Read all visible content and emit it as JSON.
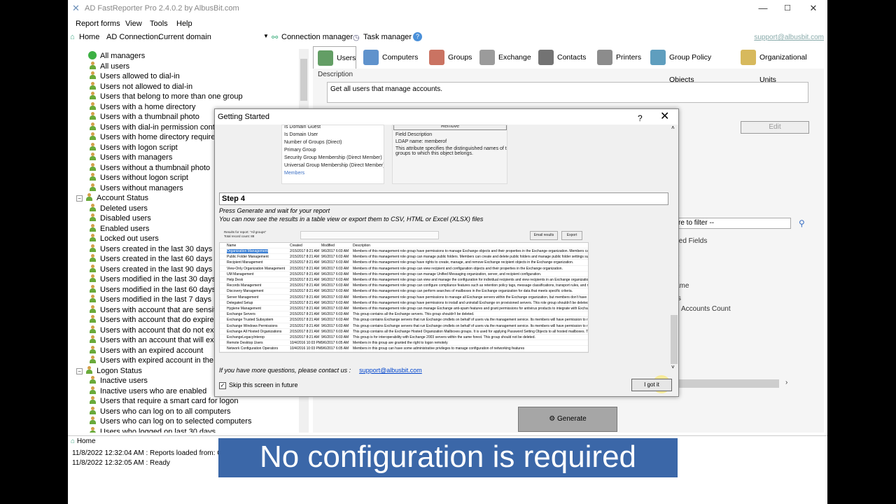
{
  "window": {
    "title": "AD FastReporter Pro 2.4.0.2 by AlbusBit.com",
    "minimize": "—",
    "maximize": "☐",
    "close": "✕"
  },
  "menu": [
    "Report forms",
    "View",
    "Tools",
    "Help"
  ],
  "toolbar": {
    "home": "Home",
    "ad_connection_label": "AD Connection:",
    "ad_connection_value": "Current domain",
    "connection_manager": "Connection manager",
    "task_manager": "Task manager",
    "help": "?",
    "support": "support@albusbit.com"
  },
  "tree": {
    "items_group1": [
      "All managers",
      "All users",
      "Users allowed to dial-in",
      "Users not allowed to dial-in",
      "Users that belong to more than one group",
      "Users with a home directory",
      "Users with a thumbnail photo",
      "Users with dial-in permission contro",
      "Users with home directory required",
      "Users with logon script",
      "Users with managers",
      "Users without a thumbnail photo",
      "Users without logon script",
      "Users without managers"
    ],
    "account_status": "Account Status",
    "items_group2": [
      "Deleted users",
      "Disabled users",
      "Enabled users",
      "Locked out users",
      "Users created in the last 30 days",
      "Users created in the last 60 days",
      "Users created in the last 90 days",
      "Users modified in the last 30 days",
      "Users modified in the last 60 days",
      "Users modified in the last 7 days",
      "Users with account that are sensitiv",
      "Users with account that do expire",
      "Users with account that do not expi",
      "Users with an account that will expi",
      "Users with an expired account",
      "Users with expired account in the la"
    ],
    "logon_status": "Logon Status",
    "items_group3": [
      "Inactive users",
      "Inactive users who are enabled",
      "Users that require a smart card for logon",
      "Users who can log on to all computers",
      "Users who can log on to selected computers",
      "Users who logged on last 30 days"
    ]
  },
  "tabs": [
    "Users",
    "Computers",
    "Groups",
    "Exchange",
    "Contacts",
    "Printers",
    "Group Policy Objects",
    "Organizational Units"
  ],
  "right": {
    "description_label": "Description",
    "description_value": "Get all users that manage accounts.",
    "edit": "Edit",
    "filter_placeholder": "re to filter --",
    "selected_fields": "cted Fields",
    "partial_e1": "e",
    "partial_e2": "e",
    "partial_ame": "ame",
    "partial_ers": "ers",
    "accounts_count": "Accounts Count",
    "generate": "Generate"
  },
  "status": {
    "home_tab": "Home",
    "log": [
      "11/8/2022 12:32:04 AM : Reports loaded from: C:\\Users",
      "11/8/2022 12:32:05 AM : Ready"
    ]
  },
  "dialog": {
    "title": "Getting Started",
    "help": "?",
    "close": "✕",
    "field_list": [
      "Is Domain Guest",
      "Is Domain User",
      "Number of Groups (Direct)",
      "Primary Group",
      "Security Group Membership (Direct Member)",
      "Universal Group Membership (Direct Member)",
      "Members"
    ],
    "remove_btn": "Remove",
    "field_desc_title": "Field Description",
    "ldap_name": "LDAP name: memberof",
    "field_desc_text": "This attribute specifies the distinguished names of the groups to which this object belongs.",
    "step_title": "Step 4",
    "step_line1": "Press Generate and wait for your report",
    "step_line2": "You can now see the results in a table view or export them to CSV, HTML or Excel (XLSX) files",
    "results_label": "Results for report: \"All groups\"",
    "total_label": "Total record count: 88",
    "email_btn": "Email results",
    "export_btn": "Export",
    "table_headers": [
      "Name",
      "Created",
      "Modified",
      "Description"
    ],
    "table_rows": [
      [
        "Organization Management",
        "2/15/2017 8:21 AM",
        "9/6/2017 6:03 AM",
        "Members of this management role group have permissions to manage Exchange objects and their properties in the Exchange organization. Members can also delegate role groups"
      ],
      [
        "Public Folder Management",
        "2/15/2017 8:21 AM",
        "9/6/2017 6:03 AM",
        "Members of this management role group can manage public folders. Members can create and delete public folders and manage public folder settings such as replicas, quotas, ag"
      ],
      [
        "Recipient Management",
        "2/15/2017 8:21 AM",
        "9/6/2017 6:03 AM",
        "Members of this management role group have rights to create, manage, and remove Exchange recipient objects in the Exchange organization."
      ],
      [
        "View-Only Organization Management",
        "2/15/2017 8:21 AM",
        "9/6/2017 6:03 AM",
        "Members of this management role group can view recipient and configuration objects and their properties in the Exchange organization."
      ],
      [
        "UM Management",
        "2/15/2017 8:21 AM",
        "9/6/2017 6:03 AM",
        "Members of this management role group can manage Unified Messaging organization, server, and recipient configuration."
      ],
      [
        "Help Desk",
        "2/15/2017 8:21 AM",
        "9/6/2017 6:03 AM",
        "Members of this management role group can view and manage the configuration for individual recipients and view recipients in an Exchange organization. Members of this role gr"
      ],
      [
        "Records Management",
        "2/15/2017 8:21 AM",
        "9/6/2017 6:03 AM",
        "Members of this management role group can configure compliance features such as retention policy tags, message classifications, transport rules, and more."
      ],
      [
        "Discovery Management",
        "2/15/2017 8:21 AM",
        "9/6/2017 6:03 AM",
        "Members of this management role group can perform searches of mailboxes in the Exchange organization for data that meets specific criteria."
      ],
      [
        "Server Management",
        "2/15/2017 8:21 AM",
        "9/6/2017 6:03 AM",
        "Members of this management role group have permissions to manage all Exchange servers within the Exchange organization, but members don't have permissions to perform ope"
      ],
      [
        "Delegated Setup",
        "2/15/2017 8:21 AM",
        "9/6/2017 6:03 AM",
        "Members of this management role group have permissions to install and uninstall Exchange on provisioned servers. This role group shouldn't be deleted."
      ],
      [
        "Hygiene Management",
        "2/15/2017 8:21 AM",
        "9/6/2017 6:03 AM",
        "Members of this management role group can manage Exchange anti-spam features and grant permissions for antivirus products to integrate with Exchange."
      ],
      [
        "Exchange Servers",
        "2/15/2017 8:21 AM",
        "9/6/2017 6:03 AM",
        "This group contains all the Exchange servers. This group shouldn't be deleted."
      ],
      [
        "Exchange Trusted Subsystem",
        "2/15/2017 8:21 AM",
        "9/6/2017 6:03 AM",
        "This group contains Exchange servers that run Exchange cmdlets on behalf of users via the management service. Its members will have permission to read and modify all Exchange"
      ],
      [
        "Exchange Windows Permissions",
        "2/15/2017 8:21 AM",
        "9/6/2017 6:03 AM",
        "This group contains Exchange servers that run Exchange cmdlets on behalf of users via the management service. Its members will have permission to read and modify all Windows a"
      ],
      [
        "Exchange All Hosted Organizations",
        "2/15/2017 8:21 AM",
        "9/6/2017 6:03 AM",
        "This group contains all the Exchange Hosted Organization Mailboxes groups. It is used for applying Password Setting Objects to all hosted mailboxes. This group should not be d"
      ],
      [
        "ExchangeLegacyInterop",
        "2/15/2017 8:21 AM",
        "9/6/2017 6:03 AM",
        "This group is for interoperability with Exchange 2003 servers within the same forest. This group should not be deleted."
      ],
      [
        "Remote Desktop Users",
        "10/4/2016 10:03 PM",
        "9/6/2017 6:05 AM",
        "Members in this group are granted the right to logon remotely"
      ],
      [
        "Network Configuration Operators",
        "10/4/2016 10:03 PM",
        "9/6/2017 6:05 AM",
        "Members in this group can have some administrative privileges to manage configuration of networking features"
      ]
    ],
    "contact_text": "If you have more questions, please contact us :",
    "contact_link": "support@albusbit.com",
    "skip_label": "Skip this screen in future",
    "skip_checked": true,
    "got_it": "I got it"
  },
  "caption": "No configuration is required",
  "colors": {
    "caption_bg": "#3b67a8",
    "user_icon_green": "#6aaa3a",
    "link_blue": "#0044cc"
  }
}
